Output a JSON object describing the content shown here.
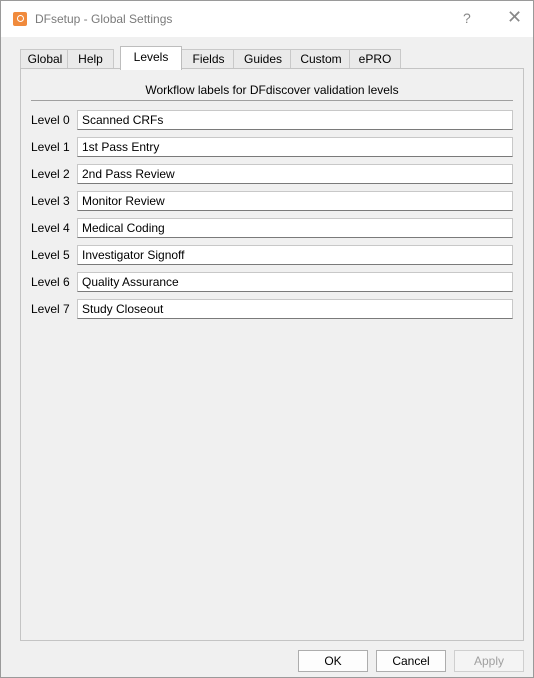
{
  "window": {
    "title": "DFsetup - Global Settings",
    "help_label": "?",
    "close_label": "✕"
  },
  "tabs": [
    {
      "label": "Global"
    },
    {
      "label": "Help"
    },
    {
      "label": "Levels"
    },
    {
      "label": "Fields"
    },
    {
      "label": "Guides"
    },
    {
      "label": "Custom"
    },
    {
      "label": "ePRO"
    }
  ],
  "active_tab": "Levels",
  "levels_pane": {
    "title": "Workflow labels for DFdiscover validation levels",
    "levels": [
      {
        "label": "Level 0",
        "value": "Scanned CRFs"
      },
      {
        "label": "Level 1",
        "value": "1st Pass Entry"
      },
      {
        "label": "Level 2",
        "value": "2nd Pass Review"
      },
      {
        "label": "Level 3",
        "value": "Monitor Review"
      },
      {
        "label": "Level 4",
        "value": "Medical Coding"
      },
      {
        "label": "Level 5",
        "value": "Investigator Signoff"
      },
      {
        "label": "Level 6",
        "value": "Quality Assurance"
      },
      {
        "label": "Level 7",
        "value": "Study Closeout"
      }
    ]
  },
  "buttons": {
    "ok": "OK",
    "cancel": "Cancel",
    "apply": "Apply",
    "apply_enabled": false
  },
  "colors": {
    "app_icon": "#f08a3c",
    "window_bg": "#f0f0f0",
    "disabled_text": "#a0a0a0"
  }
}
